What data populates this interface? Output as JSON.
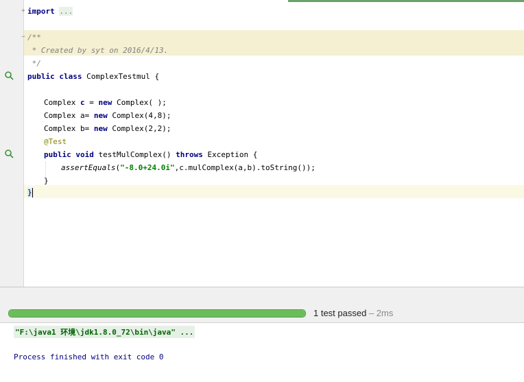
{
  "editor": {
    "lines": {
      "import_kw": "import",
      "import_dots": "...",
      "doc_open": "/**",
      "doc_body": " * Created by syt on 2016/4/13.",
      "doc_close": " */",
      "class_kw1": "public",
      "class_kw2": "class",
      "class_name": "ComplexTestmul",
      "class_brace": "{",
      "c_type": "Complex",
      "c_var": "c",
      "c_eq": "=",
      "c_new": "new",
      "c_ctor": "Complex( );",
      "a_type": "Complex",
      "a_var": "a=",
      "a_new": "new",
      "a_ctor": "Complex(4,8);",
      "b_type": "Complex",
      "b_var": "b=",
      "b_new": "new",
      "b_ctor": "Complex(2,2);",
      "annotation": "@Test",
      "m_kw1": "public",
      "m_kw2": "void",
      "m_name": "testMulComplex()",
      "m_throws": "throws",
      "m_exc": "Exception {",
      "assert_fn": "assertEquals",
      "assert_open": "(",
      "assert_str": "\"-8.0+24.0i\"",
      "assert_rest": ",c.mulComplex(a,b).toString());",
      "method_close": "}",
      "class_close": "}"
    }
  },
  "test_run": {
    "progress": 1.0,
    "status": "1 test passed",
    "time": " – 2ms",
    "progress_color": "#6bbd5b"
  },
  "console": {
    "command": "\"F:\\java1 环境\\jdk1.8.0_72\\bin\\java\" ...",
    "exit_message": "Process finished with exit code 0"
  }
}
